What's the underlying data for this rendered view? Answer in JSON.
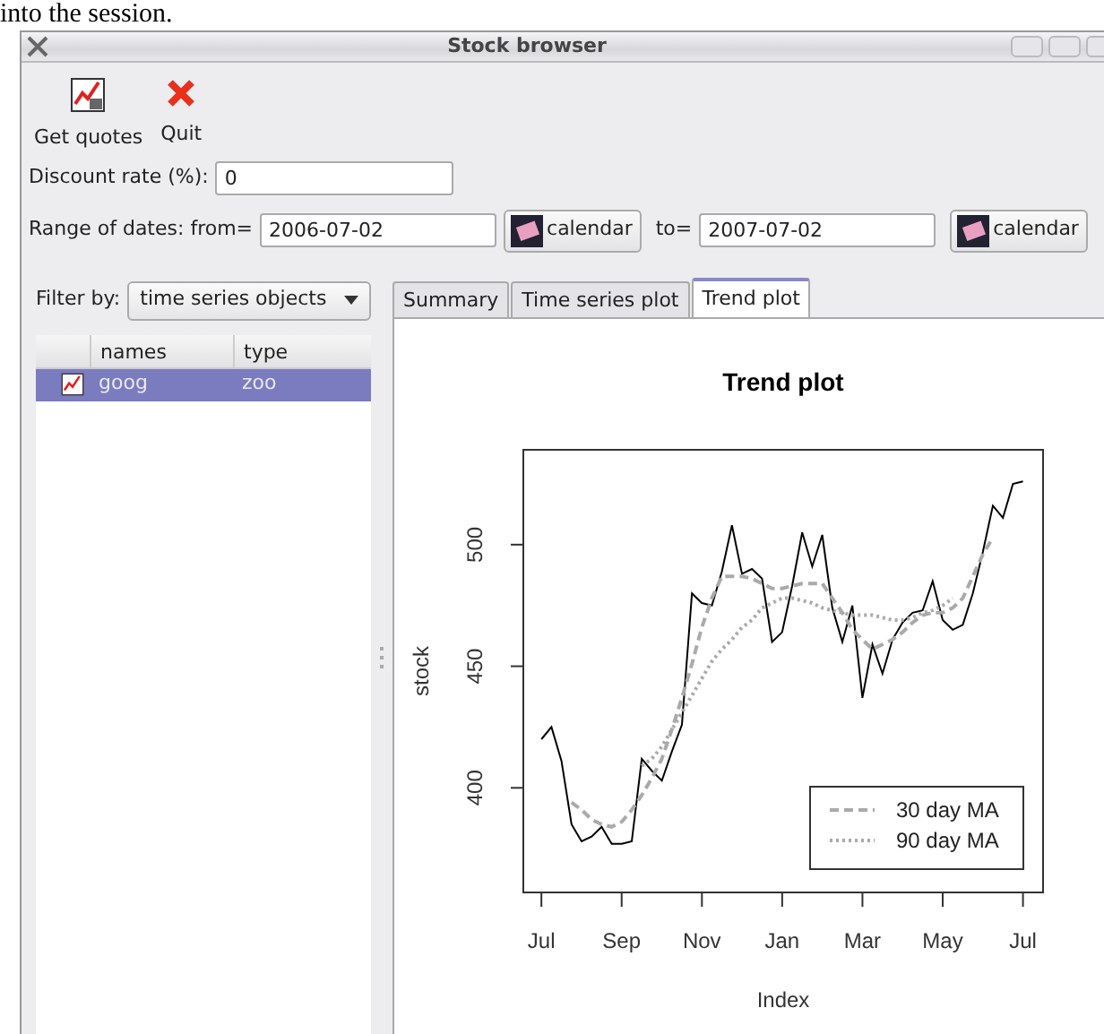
{
  "document_text": "into the session.",
  "window": {
    "title": "Stock browser"
  },
  "toolbar": [
    {
      "kind": "chart",
      "label": "Get quotes"
    },
    {
      "kind": "quit",
      "label": "Quit"
    }
  ],
  "discount": {
    "label": "Discount rate (%):",
    "value": "0"
  },
  "dates": {
    "label": "Range of dates: from=",
    "from": "2006-07-02",
    "from_button": "calendar",
    "to_label": "to=",
    "to": "2007-07-02",
    "to_button": "calendar"
  },
  "filter": {
    "label": "Filter by:",
    "value": "time series objects"
  },
  "objects": {
    "columns": [
      "names",
      "type"
    ],
    "rows": [
      {
        "name": "goog",
        "type": "zoo",
        "selected": true
      }
    ]
  },
  "tabs": [
    {
      "label": "Summary",
      "selected": false
    },
    {
      "label": "Time series plot",
      "selected": false
    },
    {
      "label": "Trend plot",
      "selected": true
    }
  ],
  "plot": {
    "chart_data": {
      "type": "line",
      "title": "Trend plot",
      "xlabel": "Index",
      "ylabel": "stock",
      "ylim": [
        357,
        539
      ],
      "legend": "bottom-right",
      "categories": [
        "Jul",
        null,
        null,
        null,
        null,
        null,
        null,
        null,
        "Sep",
        null,
        null,
        null,
        null,
        null,
        null,
        null,
        "Nov",
        null,
        null,
        null,
        null,
        null,
        null,
        null,
        "Jan",
        null,
        null,
        null,
        null,
        null,
        null,
        null,
        "Mar",
        null,
        null,
        null,
        null,
        null,
        null,
        null,
        "May",
        null,
        null,
        null,
        null,
        null,
        null,
        null,
        "Jul"
      ],
      "yticks": [
        400,
        450,
        500
      ],
      "series": [
        {
          "color": "#000000",
          "line_style": "solid",
          "values": [
            420,
            425,
            411,
            385,
            378,
            380,
            384,
            377,
            377,
            378,
            412,
            407,
            403,
            415,
            426,
            480,
            476,
            475,
            489,
            508,
            488,
            490,
            486,
            460,
            464,
            483,
            505,
            491,
            504,
            474,
            460,
            475,
            437,
            459,
            447,
            461,
            468,
            472,
            473,
            485,
            469,
            465,
            467,
            480,
            497,
            516,
            511,
            525,
            526
          ]
        },
        {
          "name": "30 day MA",
          "color": "#aaaaaa",
          "line_style": "dashed",
          "values": [
            null,
            null,
            null,
            394,
            391,
            387,
            385,
            384,
            386,
            391,
            397,
            404,
            412,
            424,
            437,
            451,
            466,
            478,
            487,
            487,
            487,
            486,
            484,
            482,
            482,
            483,
            484,
            484,
            484,
            478,
            472,
            465,
            461,
            457,
            459,
            461,
            464,
            468,
            471,
            472,
            472,
            474,
            478,
            487,
            496,
            503,
            null,
            null,
            null
          ]
        },
        {
          "name": "90 day MA",
          "color": "#aaaaaa",
          "line_style": "dotted",
          "values": [
            null,
            null,
            null,
            null,
            null,
            null,
            null,
            null,
            null,
            null,
            409,
            412,
            417,
            424,
            431,
            438,
            445,
            452,
            457,
            461,
            466,
            469,
            474,
            476,
            478,
            478,
            477,
            476,
            474,
            473,
            472,
            471,
            471,
            471,
            470,
            469,
            469,
            470,
            472,
            473,
            475,
            478,
            null,
            null,
            null,
            null,
            null,
            null,
            null
          ]
        }
      ]
    }
  }
}
